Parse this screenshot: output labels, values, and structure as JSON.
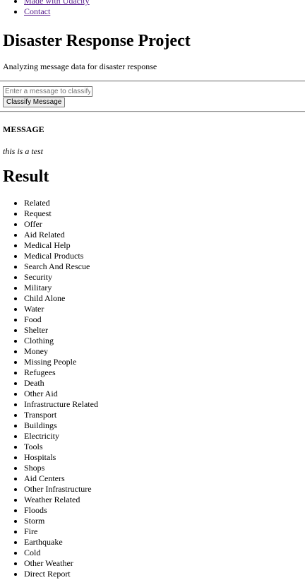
{
  "nav": {
    "links": [
      "Made with Udacity",
      "Contact"
    ]
  },
  "header": {
    "title": "Disaster Response Project",
    "subtitle": "Analyzing message data for disaster response"
  },
  "form": {
    "input_value": "",
    "input_placeholder": "Enter a message to classify",
    "button_label": "Classify Message"
  },
  "message": {
    "heading": "MESSAGE",
    "text": "this is a test"
  },
  "result": {
    "heading": "Result",
    "categories": [
      "Related",
      "Request",
      "Offer",
      "Aid Related",
      "Medical Help",
      "Medical Products",
      "Search And Rescue",
      "Security",
      "Military",
      "Child Alone",
      "Water",
      "Food",
      "Shelter",
      "Clothing",
      "Money",
      "Missing People",
      "Refugees",
      "Death",
      "Other Aid",
      "Infrastructure Related",
      "Transport",
      "Buildings",
      "Electricity",
      "Tools",
      "Hospitals",
      "Shops",
      "Aid Centers",
      "Other Infrastructure",
      "Weather Related",
      "Floods",
      "Storm",
      "Fire",
      "Earthquake",
      "Cold",
      "Other Weather",
      "Direct Report"
    ]
  },
  "colors": {
    "visited_link": "#551a8b",
    "text": "#000000",
    "background": "#ffffff"
  }
}
